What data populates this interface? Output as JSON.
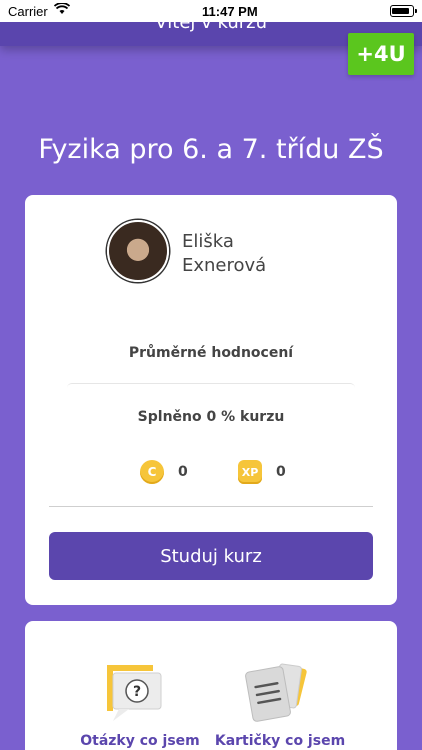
{
  "status_bar": {
    "carrier": "Carrier",
    "time": "11:47 PM"
  },
  "header": {
    "title": "Vítej v kurzu"
  },
  "logo": {
    "text": "+4U",
    "color": "#5bc61e"
  },
  "course": {
    "title": "Fyzika pro 6. a 7. třídu ZŠ"
  },
  "profile": {
    "first_name": "Eliška",
    "last_name": "Exnerová",
    "rating_label": "Průměrné hodnocení",
    "progress_label": "Splněno 0 % kurzu",
    "coins": {
      "icon_letter": "C",
      "value": "0"
    },
    "xp": {
      "icon_letter": "XP",
      "value": "0"
    },
    "study_button": "Studuj kurz"
  },
  "features": {
    "questions_label": "Otázky co jsem",
    "cards_label": "Kartičky co jsem"
  },
  "colors": {
    "background": "#7a60cf",
    "accent": "#5b46ad",
    "coin": "#f6c53a"
  }
}
